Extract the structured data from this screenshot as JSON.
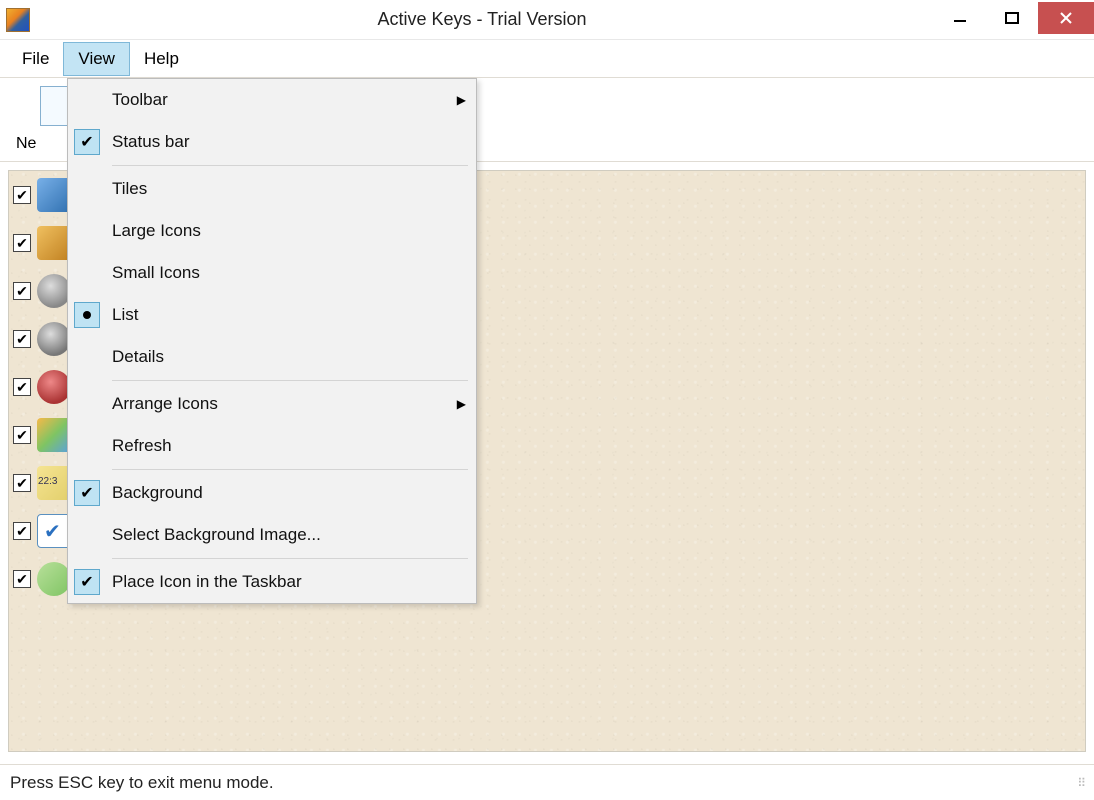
{
  "window": {
    "title": "Active Keys - Trial Version"
  },
  "menubar": {
    "file": "File",
    "view": "View",
    "help": "Help"
  },
  "toolbar": {
    "new_label_partial": "Ne"
  },
  "view_menu": {
    "toolbar": "Toolbar",
    "status_bar": "Status bar",
    "tiles": "Tiles",
    "large_icons": "Large Icons",
    "small_icons": "Small Icons",
    "list": "List",
    "details": "Details",
    "arrange_icons": "Arrange Icons",
    "refresh": "Refresh",
    "background": "Background",
    "select_bg": "Select Background Image...",
    "place_taskbar": "Place Icon in the Taskbar"
  },
  "statusbar": {
    "text": "Press ESC key to exit menu mode."
  }
}
